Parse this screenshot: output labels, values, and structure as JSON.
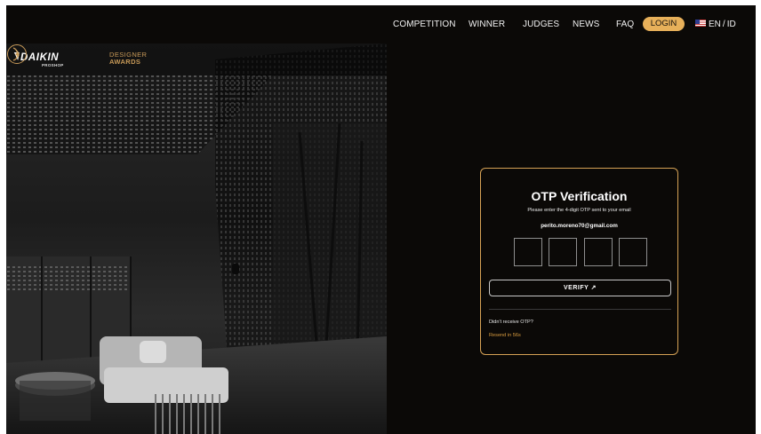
{
  "nav": {
    "items": [
      "COMPETITION",
      "WINNER",
      "JUDGES",
      "NEWS",
      "FAQ"
    ],
    "login_label": "LOGIN",
    "lang_en": "EN",
    "lang_sep": "/",
    "lang_id": "ID"
  },
  "brand": {
    "daikin": "DAIKIN",
    "proshop": "PROSHOP",
    "designer": "DESIGNER",
    "awards": "AWARDS"
  },
  "otp": {
    "title": "OTP Verification",
    "subtitle": "Please enter the 4-digit OTP sent to your email",
    "email": "perito.moreno70@gmail.com",
    "digits": [
      "",
      "",
      "",
      ""
    ],
    "verify_label": "VERIFY ↗",
    "didnt_receive": "Didn't receive OTP?",
    "resend": "Resend in 56s"
  },
  "colors": {
    "background": "#0b0907",
    "accent": "#e7b05a",
    "card_border": "#d6a255",
    "resend": "#d99c3f"
  },
  "icons": {
    "flag": "us-flag-icon",
    "verify_arrow": "arrow-up-right-icon"
  }
}
